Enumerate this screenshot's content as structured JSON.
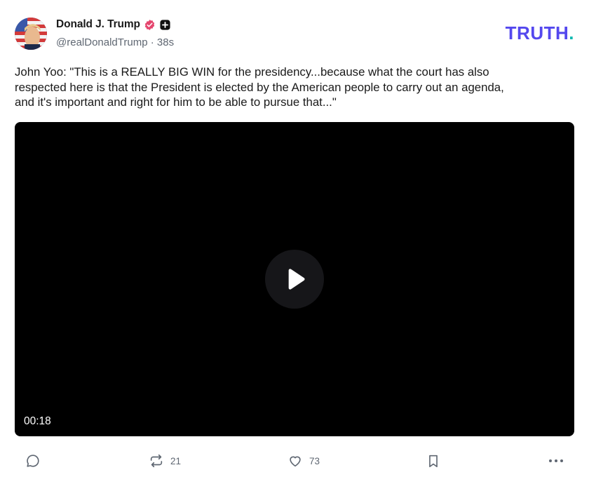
{
  "header": {
    "display_name": "Donald J. Trump",
    "handle": "@realDonaldTrump",
    "separator": "·",
    "time_ago": "38s",
    "verified_icon": "verified-badge-icon",
    "plus_icon": "plus-badge-icon",
    "logo_text": "TRUTH",
    "logo_dot": ".",
    "colors": {
      "logo": "#5448ee",
      "logo_dot": "#0fb9b1",
      "verified": "#e5466e"
    }
  },
  "post": {
    "text": "John Yoo: \"This is a REALLY BIG WIN for the presidency...because what the court has also\nrespected here is that the President is elected by the American people to carry out an agenda,\nand it's important and right for him to be able to pursue that...\""
  },
  "video": {
    "duration": "00:18",
    "play_icon": "play-icon"
  },
  "actions": {
    "reply": {
      "icon": "comment-icon"
    },
    "retruth": {
      "icon": "retruth-icon",
      "count": "21"
    },
    "like": {
      "icon": "heart-icon",
      "count": "73"
    },
    "bookmark": {
      "icon": "bookmark-icon"
    },
    "more": {
      "icon": "more-icon"
    }
  }
}
